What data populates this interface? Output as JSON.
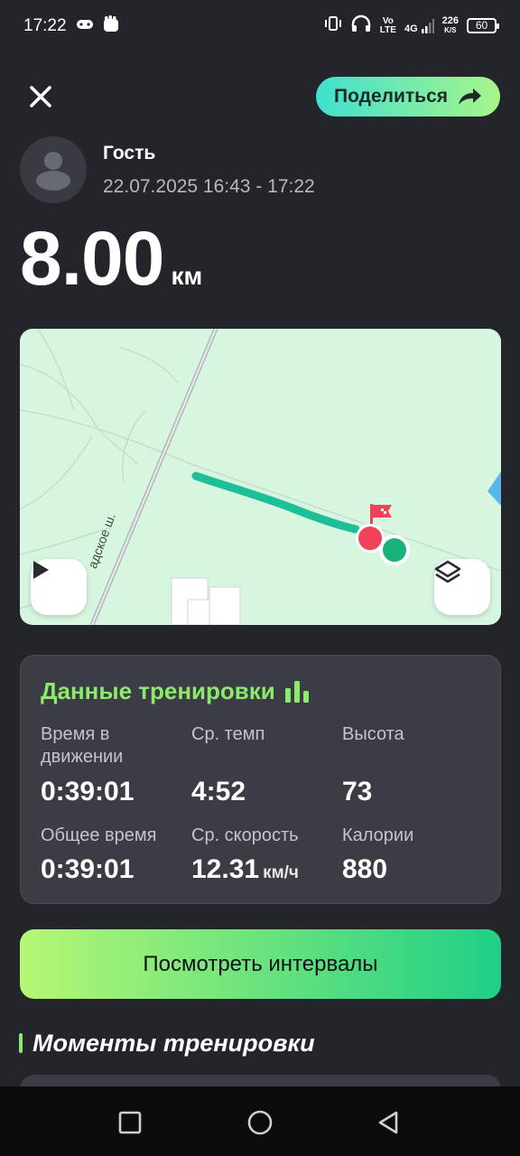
{
  "status_bar": {
    "time": "17:22",
    "vo_lte": [
      "Vo",
      "LTE"
    ],
    "network": "4G",
    "speed_value": "226",
    "speed_unit": "K/S",
    "battery": "60"
  },
  "header": {
    "close_icon": "close-icon",
    "share_label": "Поделиться",
    "share_icon": "share-arrow-icon"
  },
  "user": {
    "name": "Гость",
    "datetime": "22.07.2025 16:43 - 17:22"
  },
  "distance": {
    "value": "8.00",
    "unit": "км"
  },
  "map": {
    "road_label": "адское ш.",
    "route_color": "#1ebf98",
    "start_color": "#19b37a",
    "finish_color": "#f0435a",
    "controls": [
      "play-icon",
      "layers-icon"
    ]
  },
  "stats": {
    "title": "Данные тренировки",
    "items": [
      {
        "label": "Время в движении",
        "value": "0:39:01",
        "unit": ""
      },
      {
        "label": "Ср. темп",
        "value": "4:52",
        "unit": ""
      },
      {
        "label": "Высота",
        "value": "73",
        "unit": ""
      },
      {
        "label": "Общее время",
        "value": "0:39:01",
        "unit": ""
      },
      {
        "label": "Ср. скорость",
        "value": "12.31",
        "unit": "км/ч"
      },
      {
        "label": "Калории",
        "value": "880",
        "unit": ""
      }
    ]
  },
  "intervals_button": {
    "label": "Посмотреть интервалы"
  },
  "moments": {
    "title": "Моменты тренировки"
  },
  "navbar": {
    "icons": [
      "recent-apps-icon",
      "home-icon",
      "back-icon"
    ]
  },
  "colors": {
    "background": "#24252b",
    "accent_green": "#8bea6b",
    "card": "#3b3c44"
  }
}
